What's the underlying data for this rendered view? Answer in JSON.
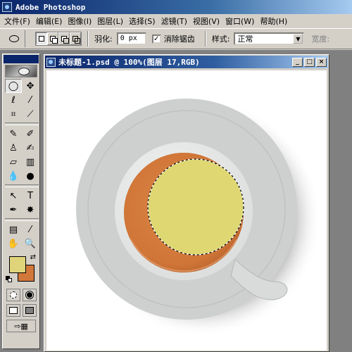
{
  "app": {
    "title": "Adobe Photoshop"
  },
  "menu": [
    "文件(F)",
    "编辑(E)",
    "图像(I)",
    "图层(L)",
    "选择(S)",
    "滤镜(T)",
    "视图(V)",
    "窗口(W)",
    "帮助(H)"
  ],
  "options": {
    "feather_label": "羽化:",
    "feather_value": "0 px",
    "antialias_label": "消除锯齿",
    "antialias_checked": true,
    "style_label": "样式:",
    "style_value": "正常",
    "width_label": "宽度:"
  },
  "toolbox": {
    "foreground_color": "#e0d47a",
    "background_color": "#d2773a"
  },
  "document": {
    "title": "未标题-1.psd @ 100%(图层 17,RGB)",
    "zoom": "100%",
    "layer": "图层 17",
    "mode": "RGB"
  },
  "window_buttons": {
    "minimize": "_",
    "maximize": "□",
    "close": "×"
  },
  "colors": {
    "tea": "#d2773a",
    "selection_fill": "#ded772",
    "saucer": "#cdd0ce",
    "cup_rim": "#e7e9e8"
  }
}
